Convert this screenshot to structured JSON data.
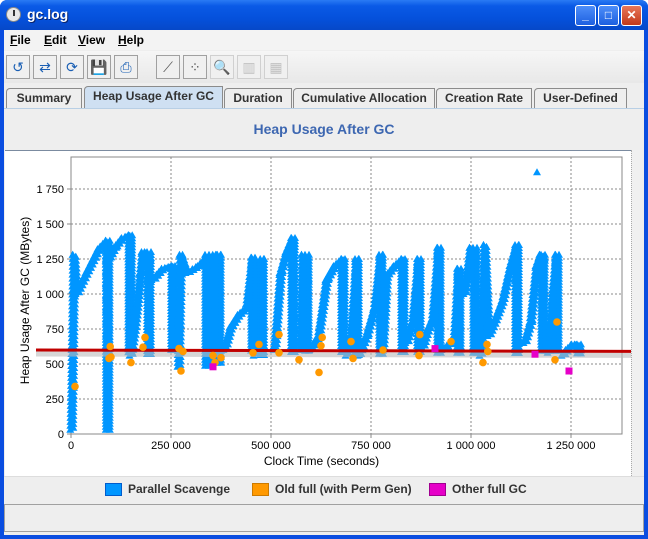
{
  "window": {
    "title": "gc.log",
    "buttons": [
      "minimize",
      "maximize",
      "close"
    ]
  },
  "menu": [
    {
      "label": "File",
      "mnemonic": "F",
      "rest": "ile"
    },
    {
      "label": "Edit",
      "mnemonic": "E",
      "rest": "dit"
    },
    {
      "label": "View",
      "mnemonic": "V",
      "rest": "iew"
    },
    {
      "label": "Help",
      "mnemonic": "H",
      "rest": "elp"
    }
  ],
  "toolbar": [
    {
      "name": "reload-icon",
      "glyph": "↺",
      "enabled": true
    },
    {
      "name": "export-icon",
      "glyph": "⇄",
      "enabled": true
    },
    {
      "name": "refresh-icon",
      "glyph": "⟳",
      "enabled": true
    },
    {
      "name": "save-icon",
      "glyph": "💾",
      "enabled": true
    },
    {
      "name": "print-icon",
      "glyph": "⎙",
      "enabled": true
    },
    {
      "name": "trend-line-icon",
      "glyph": "⟋",
      "enabled": true
    },
    {
      "name": "scatter-icon",
      "glyph": "⁘",
      "enabled": true
    },
    {
      "name": "zoom-icon",
      "glyph": "🔍",
      "enabled": false
    },
    {
      "name": "bar-chart-icon",
      "glyph": "▥",
      "enabled": false
    },
    {
      "name": "histogram-icon",
      "glyph": "▦",
      "enabled": false
    }
  ],
  "tabs": [
    {
      "label": "Summary",
      "active": false
    },
    {
      "label": "Heap Usage After GC",
      "active": true
    },
    {
      "label": "Duration",
      "active": false
    },
    {
      "label": "Cumulative Allocation",
      "active": false
    },
    {
      "label": "Creation Rate",
      "active": false
    },
    {
      "label": "User-Defined",
      "active": false
    }
  ],
  "chart_data": {
    "type": "scatter",
    "title": "Heap Usage After GC",
    "xlabel": "Clock Time  (seconds)",
    "ylabel": "Heap Usage After GC  (MBytes)",
    "xlim": [
      0,
      1350000
    ],
    "ylim": [
      0,
      1960
    ],
    "xticks": [
      0,
      250000,
      500000,
      750000,
      1000000,
      1250000
    ],
    "xtick_labels": [
      "0",
      "250 000",
      "500 000",
      "750 000",
      "1 000 000",
      "1 250 000"
    ],
    "yticks": [
      0,
      250,
      500,
      750,
      1000,
      1250,
      1500,
      1750
    ],
    "ytick_labels": [
      "0",
      "250",
      "500",
      "750",
      "1 000",
      "1 250",
      "1 500",
      "1 750"
    ],
    "grid": true,
    "legend_position": "bottom",
    "trend_line": {
      "color": "#c00000",
      "y_start": 600,
      "y_end": 590
    },
    "series": [
      {
        "name": "Parallel Scavenge",
        "color": "#0096ff",
        "marker": "triangle",
        "segments": [
          [
            [
              2000,
              30
            ],
            [
              5000,
              600
            ],
            [
              8000,
              1280
            ],
            [
              15000,
              1000
            ],
            [
              40000,
              1150
            ],
            [
              70000,
              1320
            ],
            [
              90000,
              1380
            ],
            [
              92000,
              580
            ]
          ],
          [
            [
              95000,
              1250
            ],
            [
              110000,
              1330
            ],
            [
              130000,
              1400
            ],
            [
              148000,
              1420
            ]
          ],
          [
            [
              150000,
              560
            ],
            [
              160000,
              750
            ],
            [
              175000,
              1150
            ],
            [
              180000,
              1300
            ],
            [
              195000,
              1250
            ]
          ],
          [
            [
              205000,
              1100
            ],
            [
              230000,
              1180
            ],
            [
              255000,
              1200
            ]
          ],
          [
            [
              270000,
              480
            ],
            [
              275000,
              1280
            ],
            [
              290000,
              1150
            ],
            [
              320000,
              1200
            ],
            [
              340000,
              1260
            ]
          ],
          [
            [
              355000,
              500
            ],
            [
              358000,
              1280
            ],
            [
              370000,
              1280
            ]
          ],
          [
            [
              385000,
              600
            ],
            [
              400000,
              760
            ],
            [
              420000,
              850
            ],
            [
              440000,
              900
            ],
            [
              455000,
              1260
            ]
          ],
          [
            [
              460000,
              560
            ],
            [
              468000,
              1100
            ],
            [
              478000,
              1250
            ]
          ],
          [
            [
              510000,
              600
            ],
            [
              525000,
              1150
            ],
            [
              540000,
              1300
            ],
            [
              555000,
              1400
            ]
          ],
          [
            [
              575000,
              600
            ],
            [
              580000,
              1280
            ],
            [
              590000,
              1100
            ]
          ],
          [
            [
              600000,
              600
            ],
            [
              620000,
              700
            ],
            [
              640000,
              1100
            ],
            [
              660000,
              1200
            ],
            [
              680000,
              1250
            ]
          ],
          [
            [
              690000,
              560
            ],
            [
              700000,
              650
            ],
            [
              715000,
              1250
            ]
          ],
          [
            [
              720000,
              560
            ],
            [
              740000,
              700
            ],
            [
              760000,
              900
            ],
            [
              775000,
              1280
            ]
          ],
          [
            [
              780000,
              600
            ],
            [
              790000,
              1130
            ],
            [
              810000,
              1200
            ],
            [
              830000,
              1250
            ]
          ],
          [
            [
              840000,
              650
            ],
            [
              855000,
              800
            ],
            [
              870000,
              1250
            ]
          ],
          [
            [
              880000,
              620
            ],
            [
              890000,
              720
            ],
            [
              905000,
              820
            ],
            [
              920000,
              1330
            ]
          ],
          [
            [
              930000,
              600
            ],
            [
              950000,
              650
            ],
            [
              960000,
              700
            ],
            [
              970000,
              1180
            ]
          ],
          [
            [
              985000,
              1000
            ],
            [
              1000000,
              1330
            ],
            [
              1010000,
              1280
            ]
          ],
          [
            [
              1025000,
              560
            ],
            [
              1035000,
              1350
            ],
            [
              1045000,
              700
            ],
            [
              1060000,
              800
            ],
            [
              1080000,
              950
            ],
            [
              1100000,
              1200
            ],
            [
              1115000,
              1350
            ]
          ],
          [
            [
              1135000,
              650
            ],
            [
              1150000,
              800
            ],
            [
              1165000,
              1200
            ],
            [
              1175000,
              1280
            ],
            [
              1180000,
              1250
            ]
          ],
          [
            [
              1195000,
              580
            ],
            [
              1205000,
              1000
            ],
            [
              1215000,
              1280
            ]
          ],
          [
            [
              1230000,
              560
            ],
            [
              1240000,
              600
            ],
            [
              1255000,
              640
            ],
            [
              1270000,
              630
            ]
          ],
          [
            [
              1165000,
              1870
            ]
          ]
        ]
      },
      {
        "name": "Old full (with Perm Gen)",
        "color": "#ff9900",
        "marker": "circle",
        "points": [
          [
            10000,
            340
          ],
          [
            95000,
            540
          ],
          [
            100000,
            550
          ],
          [
            98000,
            625
          ],
          [
            150000,
            510
          ],
          [
            180000,
            620
          ],
          [
            185000,
            690
          ],
          [
            275000,
            450
          ],
          [
            270000,
            610
          ],
          [
            280000,
            590
          ],
          [
            355000,
            560
          ],
          [
            360000,
            510
          ],
          [
            375000,
            545
          ],
          [
            455000,
            580
          ],
          [
            470000,
            640
          ],
          [
            520000,
            710
          ],
          [
            520000,
            580
          ],
          [
            570000,
            530
          ],
          [
            620000,
            440
          ],
          [
            625000,
            630
          ],
          [
            628000,
            690
          ],
          [
            700000,
            660
          ],
          [
            705000,
            540
          ],
          [
            780000,
            600
          ],
          [
            870000,
            560
          ],
          [
            872000,
            710
          ],
          [
            950000,
            660
          ],
          [
            1030000,
            510
          ],
          [
            1040000,
            640
          ],
          [
            1042000,
            590
          ],
          [
            1210000,
            530
          ],
          [
            1215000,
            800
          ]
        ]
      },
      {
        "name": "Other full GC",
        "color": "#e600c8",
        "marker": "square",
        "points": [
          [
            355000,
            480
          ],
          [
            910000,
            610
          ],
          [
            1160000,
            570
          ],
          [
            1245000,
            450
          ]
        ]
      }
    ]
  },
  "legend": [
    {
      "label": "Parallel Scavenge",
      "color": "#0096ff",
      "border": "#005ccc"
    },
    {
      "label": "Old full (with Perm Gen)",
      "color": "#ff9900",
      "border": "#cc7a00"
    },
    {
      "label": "Other full GC",
      "color": "#e600c8",
      "border": "#a00090"
    }
  ],
  "statusbar": {
    "text": ""
  }
}
